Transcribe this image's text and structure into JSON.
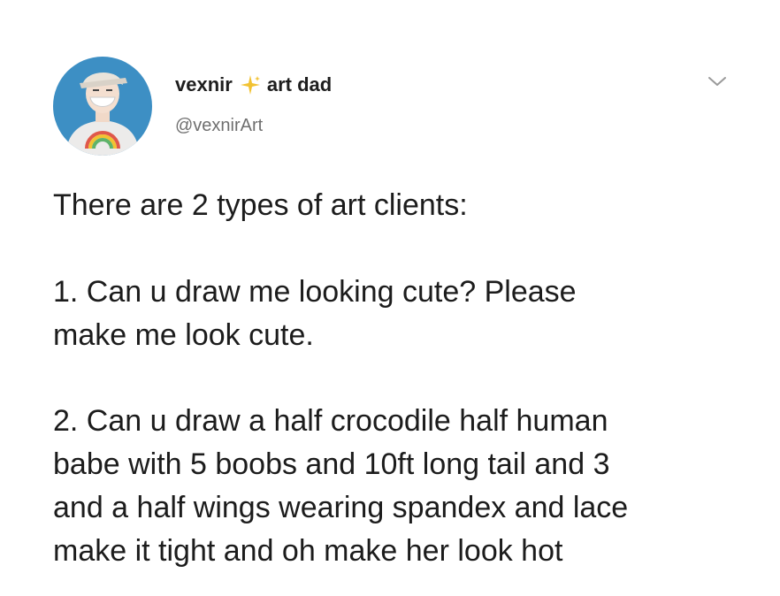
{
  "tweet": {
    "display_name": "vexnir",
    "name_suffix": "art dad",
    "handle": "@vexnirArt",
    "lines": [
      "There are 2 types of art clients:",
      "1. Can u draw me looking cute? Please",
      "make me look cute.",
      "2. Can u draw a half crocodile half human",
      "babe with 5 boobs and 10ft long tail and 3",
      "and a half wings wearing spandex and lace",
      "make it tight and oh make her look hot"
    ]
  },
  "icons": {
    "name_emoji": "sparkle-icon",
    "menu": "chevron-down-icon"
  },
  "colors": {
    "sparkle": "#f2c232",
    "avatar_bg": "#3d8fc4",
    "handle": "#6f6f6f"
  }
}
